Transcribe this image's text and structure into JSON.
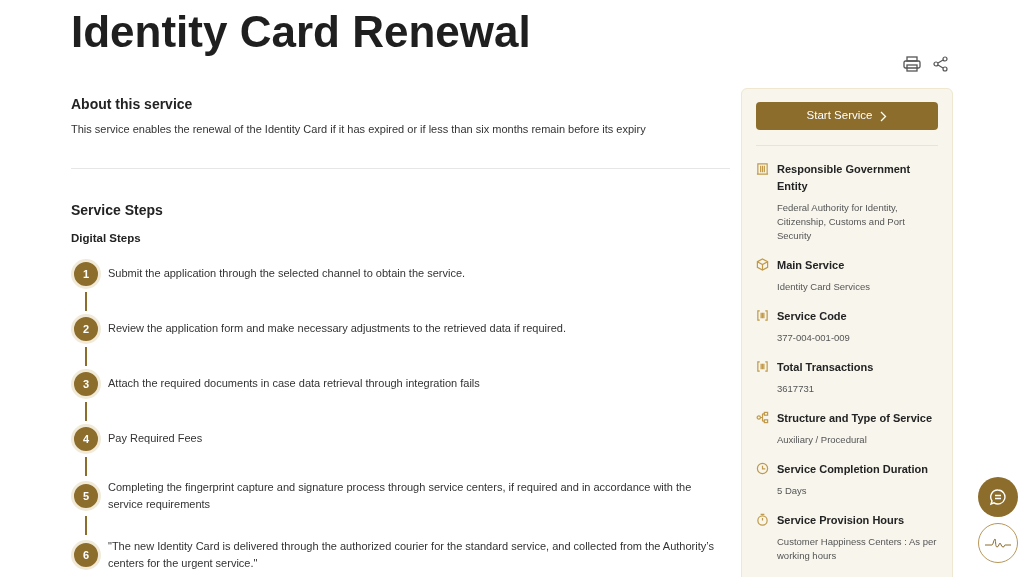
{
  "title": "Identity Card Renewal",
  "about": {
    "heading": "About this service",
    "text": "This service enables the renewal of the Identity Card if it has expired or if less than six months remain before its expiry"
  },
  "steps_section": {
    "heading": "Service Steps",
    "subheading": "Digital Steps",
    "steps": [
      {
        "number": "1",
        "text": "Submit the application through the selected channel to obtain the service."
      },
      {
        "number": "2",
        "text": "Review the application form and make necessary adjustments to the retrieved data if required."
      },
      {
        "number": "3",
        "text": "Attach the required documents in case data retrieval through integration fails"
      },
      {
        "number": "4",
        "text": "Pay Required Fees"
      },
      {
        "number": "5",
        "text": "Completing the fingerprint capture and signature process through service centers, if required and in accordance with the service requirements"
      },
      {
        "number": "6",
        "text": "\"The new Identity Card is delivered through the authorized courier for the standard service, and collected from the Authority’s centers for the urgent service.\""
      }
    ]
  },
  "sidebar": {
    "start_button": "Start Service",
    "items": [
      {
        "kind": "building",
        "label": "Responsible Government Entity",
        "value": "Federal Authority for Identity, Citizenship, Customs and Port Security"
      },
      {
        "kind": "box",
        "label": "Main Service",
        "value": "Identity Card Services"
      },
      {
        "kind": "code",
        "label": "Service Code",
        "value": "377-004-001-009"
      },
      {
        "kind": "code",
        "label": "Total Transactions",
        "value": "3617731"
      },
      {
        "kind": "structure",
        "label": "Structure and Type of Service",
        "value": "Auxiliary / Procedural"
      },
      {
        "kind": "clock",
        "label": "Service Completion Duration",
        "value": "5 Days"
      },
      {
        "kind": "timer",
        "label": "Service Provision Hours",
        "value": "Customer Happiness Centers : As per working hours"
      }
    ]
  }
}
